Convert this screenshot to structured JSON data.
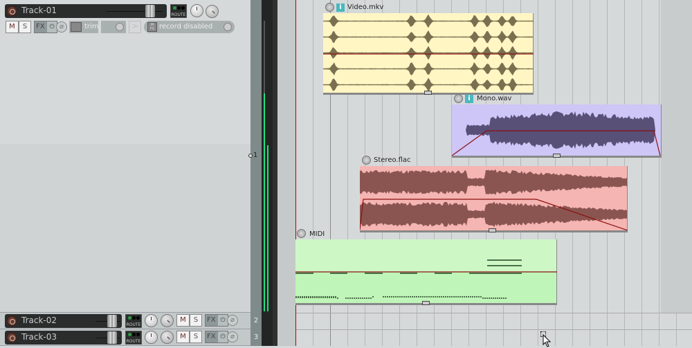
{
  "tracks": [
    {
      "name": "Track-01",
      "number": "1",
      "route": "ROUTE",
      "mute": "M",
      "solo": "S",
      "fx": "FX",
      "fx_power": "⏻",
      "phase": "⌀",
      "trim": "trim",
      "input": "record disabled",
      "in_fx": "IN FX"
    },
    {
      "name": "Track-02",
      "number": "2",
      "route": "ROUTE",
      "mute": "M",
      "solo": "S",
      "fx": "FX",
      "fx_power": "⏻",
      "phase": "⌀"
    },
    {
      "name": "Track-03",
      "number": "3",
      "route": "ROUTE",
      "mute": "M",
      "solo": "S",
      "fx": "FX",
      "fx_power": "⏻",
      "phase": "⌀"
    }
  ],
  "items": [
    {
      "name": "Video.mkv",
      "color": "#fff6c4",
      "wave": "#7a7050",
      "info": "i"
    },
    {
      "name": "Mono.wav",
      "color": "#cdc6f6",
      "wave": "#595078",
      "info": "i"
    },
    {
      "name": "Stereo.flac",
      "color": "#f5b5b2",
      "wave": "#8a5550"
    },
    {
      "name": "MIDI",
      "color": "#c6f6c0",
      "wave": "#4a7048"
    }
  ],
  "colors": {
    "cursor": "#8a1010",
    "meter": "#20e080"
  }
}
